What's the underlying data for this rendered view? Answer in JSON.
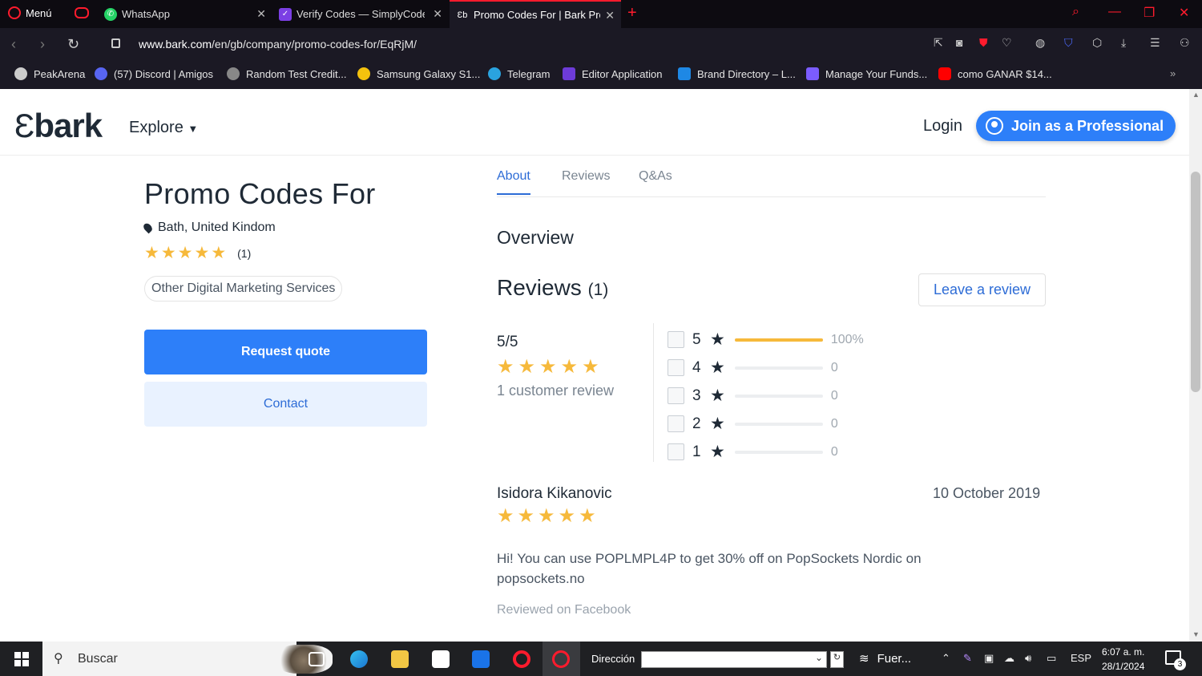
{
  "browser": {
    "menu_label": "Menú",
    "tabs": [
      {
        "title": "WhatsApp",
        "icon": "whatsapp-icon"
      },
      {
        "title": "Verify Codes — SimplyCodes",
        "icon": "simplycodes-icon"
      },
      {
        "title": "Promo Codes For | Bark Pro",
        "icon": "bark-icon"
      }
    ],
    "url_domain": "www.bark.com",
    "url_path": "/en/gb/company/promo-codes-for/EqRjM/",
    "bookmarks": [
      {
        "label": "PeakArena",
        "color": "#cccccc"
      },
      {
        "label": "(57) Discord | Amigos",
        "color": "#5865f2"
      },
      {
        "label": "Random Test Credit...",
        "color": "#888888"
      },
      {
        "label": "Samsung Galaxy S1...",
        "color": "#f4c20d"
      },
      {
        "label": "Telegram",
        "color": "#2aa3df"
      },
      {
        "label": "Editor Application",
        "color": "#6d3bd8"
      },
      {
        "label": "Brand Directory – L...",
        "color": "#1e88e5"
      },
      {
        "label": "Manage Your Funds...",
        "color": "#7b5cff"
      },
      {
        "label": "como GANAR $14...",
        "color": "#ff0000"
      }
    ]
  },
  "site": {
    "logo": "bark",
    "explore": "Explore",
    "login": "Login",
    "join": "Join as a Professional"
  },
  "company": {
    "name": "Promo Codes For",
    "location": "Bath, United Kindom",
    "rating_count": "(1)",
    "category": "Other Digital Marketing Services",
    "request_quote": "Request quote",
    "contact": "Contact"
  },
  "page_tabs": [
    "About",
    "Reviews",
    "Q&As"
  ],
  "overview": "Overview",
  "reviews": {
    "heading": "Reviews",
    "count": "(1)",
    "leave_review": "Leave a review",
    "score": "5/5",
    "customer_reviews": "1 customer review",
    "histogram": [
      {
        "stars": "5",
        "fraction": 1.0,
        "label": "100%"
      },
      {
        "stars": "4",
        "fraction": 0,
        "label": "0"
      },
      {
        "stars": "3",
        "fraction": 0,
        "label": "0"
      },
      {
        "stars": "2",
        "fraction": 0,
        "label": "0"
      },
      {
        "stars": "1",
        "fraction": 0,
        "label": "0"
      }
    ],
    "items": [
      {
        "author": "Isidora Kikanovic",
        "date": "10 October 2019",
        "rating": 5,
        "text": "Hi! You can use POPLMPL4P to get 30% off on PopSockets Nordic on popsockets.no",
        "source": "Reviewed on Facebook"
      }
    ]
  },
  "taskbar": {
    "search_placeholder": "Buscar",
    "address_label": "Dirección",
    "weather": "Fuer...",
    "language": "ESP",
    "time": "6:07 a. m.",
    "date": "28/1/2024",
    "notifications": "3"
  },
  "colors": {
    "accent": "#2d7ff9",
    "star": "#f6b93b",
    "opera_red": "#ff1b2d"
  }
}
